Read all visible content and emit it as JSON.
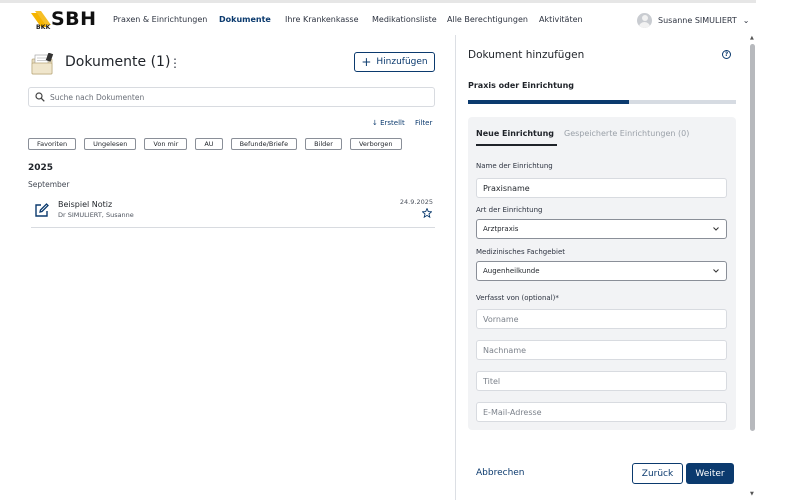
{
  "header": {
    "logo_small": "BKK",
    "logo_big": "SBH",
    "nav": [
      {
        "label": "Praxen & Einrichtungen",
        "active": false
      },
      {
        "label": "Dokumente",
        "active": true
      },
      {
        "label": "Ihre Krankenkasse",
        "active": false
      },
      {
        "label": "Medikationsliste",
        "active": false
      },
      {
        "label": "Alle Berechtigungen",
        "active": false
      },
      {
        "label": "Aktivitäten",
        "active": false
      }
    ],
    "user_name": "Susanne SIMULIERT"
  },
  "documents": {
    "title": "Dokumente (1)",
    "add_label": "Hinzufügen",
    "search_placeholder": "Suche nach Dokumenten",
    "sort_label": "Erstellt",
    "filter_label": "Filter",
    "chips": [
      "Favoriten",
      "Ungelesen",
      "Von mir",
      "AU",
      "Befunde/Briefe",
      "Bilder",
      "Verborgen"
    ],
    "year": "2025",
    "month": "September",
    "items": [
      {
        "name": "Beispiel Notiz",
        "author": "Dr SIMULIERT, Susanne",
        "date": "24.9.2025"
      }
    ]
  },
  "panel": {
    "title": "Dokument hinzufügen",
    "step_title": "Praxis oder Einrichtung",
    "progress": 0.6,
    "tabs": [
      "Neue Einrichtung",
      "Gespeicherte Einrichtungen (0)"
    ],
    "name_label": "Name der Einrichtung",
    "name_value": "Praxisname",
    "type_label": "Art der Einrichtung",
    "type_value": "Arztpraxis",
    "field_label": "Medizinisches Fachgebiet",
    "field_value": "Augenheilkunde",
    "author_label": "Verfasst von (optional)*",
    "firstname_placeholder": "Vorname",
    "lastname_placeholder": "Nachname",
    "title_placeholder": "Titel",
    "email_placeholder": "E-Mail-Adresse",
    "cancel_label": "Abbrechen",
    "back_label": "Zurück",
    "next_label": "Weiter"
  },
  "colors": {
    "primary": "#0b3a6e",
    "logo_yellow": "#f5b400"
  }
}
